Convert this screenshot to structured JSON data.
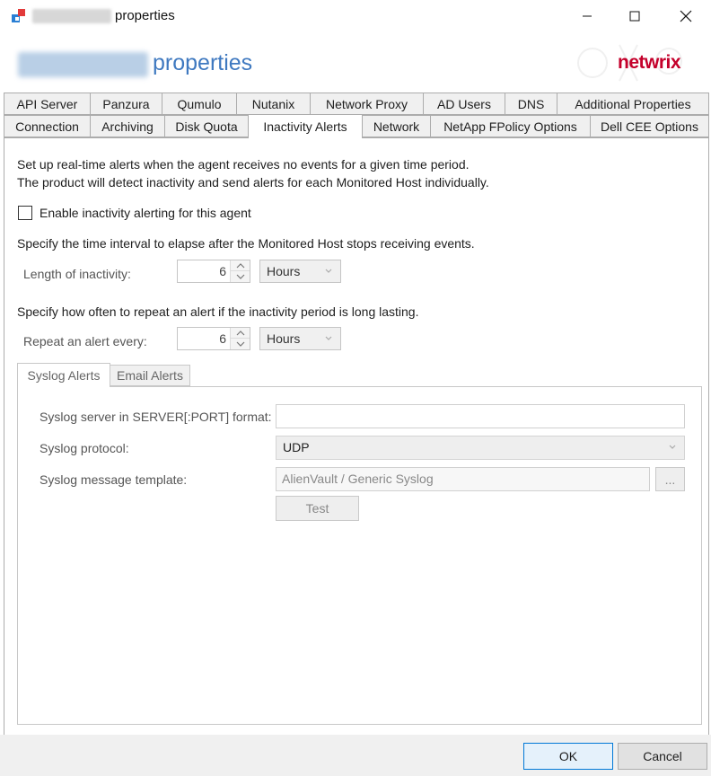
{
  "window": {
    "title": "properties",
    "header_title": "properties",
    "brand": "netwrix"
  },
  "tabs_row1": [
    "API Server",
    "Panzura",
    "Qumulo",
    "Nutanix",
    "Network Proxy",
    "AD Users",
    "DNS",
    "Additional Properties"
  ],
  "tabs_row2": [
    "Connection",
    "Archiving",
    "Disk Quota",
    "Inactivity Alerts",
    "Network",
    "NetApp FPolicy Options",
    "Dell CEE Options"
  ],
  "active_tab": "Inactivity Alerts",
  "content": {
    "intro_line1": "Set up real-time alerts when the agent receives no events for a given time period.",
    "intro_line2": "The product will detect inactivity and send alerts for each Monitored Host individually.",
    "enable_checkbox_label": "Enable inactivity alerting for this agent",
    "enable_checked": false,
    "interval_desc": "Specify the time interval to elapse after the Monitored Host stops receiving events.",
    "length_label": "Length of inactivity:",
    "length_value": "6",
    "length_unit": "Hours",
    "repeat_desc": "Specify how often to repeat an alert if the inactivity period is long lasting.",
    "repeat_label": "Repeat an alert every:",
    "repeat_value": "6",
    "repeat_unit": "Hours"
  },
  "inner_tabs": [
    "Syslog Alerts",
    "Email Alerts"
  ],
  "syslog": {
    "server_label": "Syslog server in SERVER[:PORT] format:",
    "server_value": "",
    "protocol_label": "Syslog protocol:",
    "protocol_value": "UDP",
    "template_label": "Syslog message template:",
    "template_value": "AlienVault / Generic Syslog",
    "browse_label": "...",
    "test_label": "Test"
  },
  "footer": {
    "ok_label": "OK",
    "cancel_label": "Cancel"
  },
  "colors": {
    "header_blue": "#3f79c0",
    "brand_red": "#c4002b",
    "ok_border": "#0078d7"
  }
}
